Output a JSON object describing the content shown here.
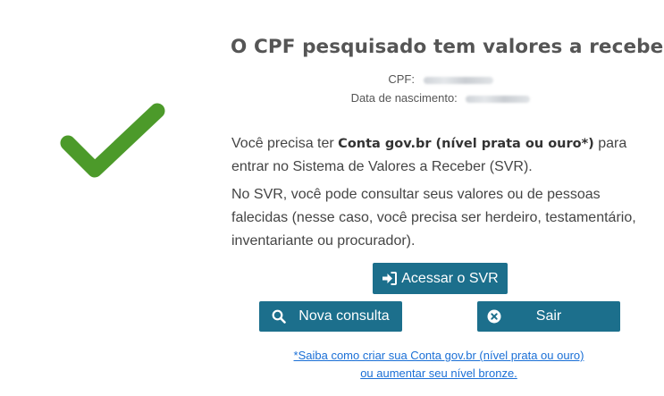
{
  "result": {
    "title": "O CPF pesquisado tem valores a receber",
    "status_icon": "check-mark-icon",
    "cpf_label": "CPF:",
    "dob_label": "Data de nascimento:"
  },
  "message": {
    "p1_prefix": "Você precisa ter ",
    "p1_bold": "Conta gov.br (nível prata ou ouro*)",
    "p1_suffix": " para entrar no Sistema de Valores a Receber (SVR).",
    "p2": "No SVR, você pode consultar seus valores ou de pessoas falecidas (nesse caso, você precisa ser herdeiro, testamentário, inventariante ou procurador)."
  },
  "actions": {
    "access_label": "Acessar o SVR",
    "access_icon": "sign-in-icon",
    "new_query_label": "Nova consulta",
    "new_query_icon": "search-icon",
    "exit_label": "Sair",
    "exit_icon": "close-circle-icon"
  },
  "help": {
    "line1": "*Saiba como criar sua Conta gov.br (nível prata ou ouro)",
    "line2": "ou aumentar seu nível bronze."
  },
  "colors": {
    "check_green": "#4c9a2a",
    "button_bg": "#1c6f8c",
    "link": "#1a6fd6",
    "text": "#444444"
  }
}
